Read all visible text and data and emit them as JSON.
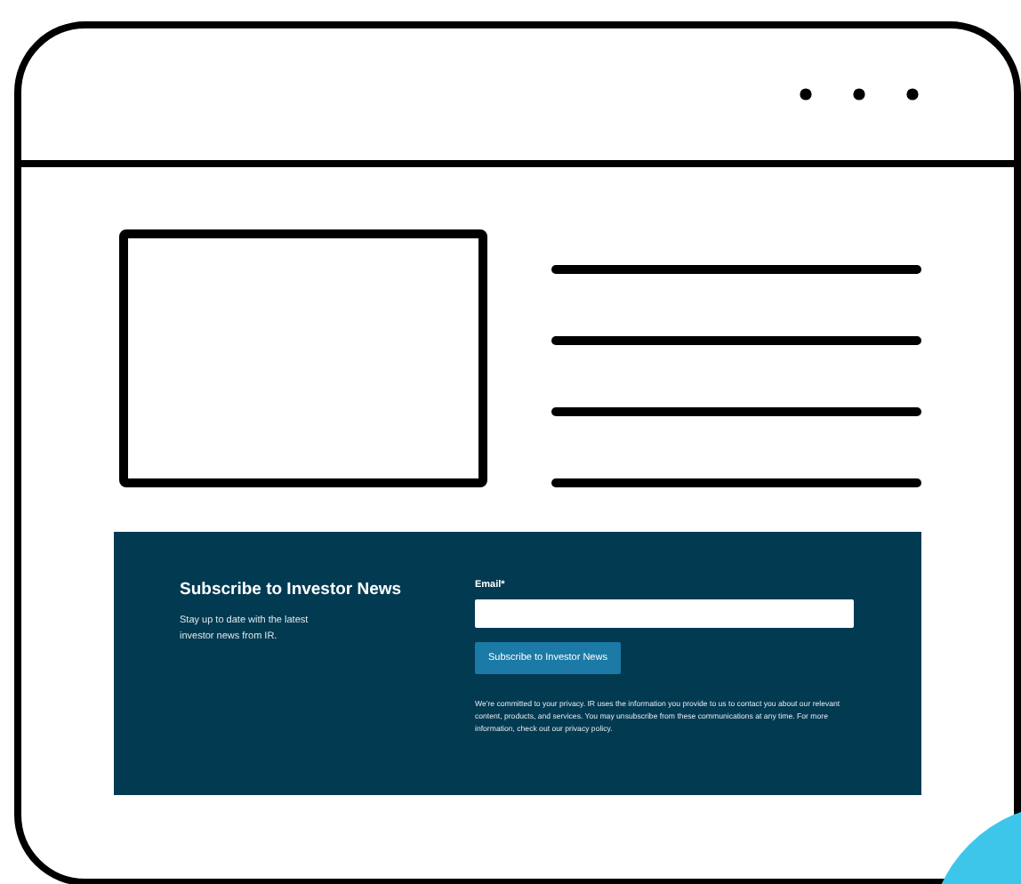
{
  "subscribe_panel": {
    "title": "Subscribe to Investor News",
    "description": "Stay up to date with the latest investor news from IR.",
    "email_label": "Email*",
    "button": "Subscribe to Investor News",
    "privacy_note": "We're committed to your privacy. IR uses the information you provide to us to contact you about our relevant content, products, and services. You may unsubscribe from these communications at any time. For more information, check out our privacy policy."
  }
}
